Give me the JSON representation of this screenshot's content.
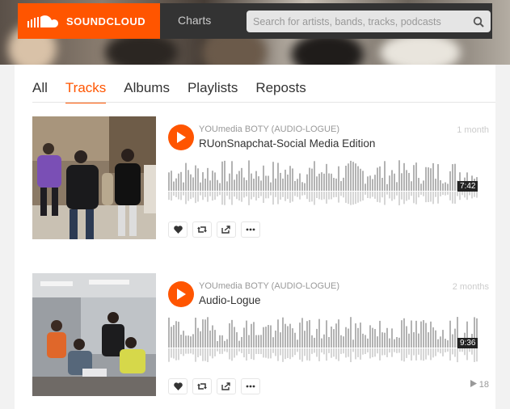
{
  "header": {
    "brand": "SOUNDCLOUD",
    "nav_charts": "Charts",
    "search_placeholder": "Search for artists, bands, tracks, podcasts"
  },
  "tabs": [
    {
      "label": "All",
      "active": false
    },
    {
      "label": "Tracks",
      "active": true
    },
    {
      "label": "Albums",
      "active": false
    },
    {
      "label": "Playlists",
      "active": false
    },
    {
      "label": "Reposts",
      "active": false
    }
  ],
  "tracks": [
    {
      "uploader": "YOUmedia BOTY (AUDIO-LOGUE)",
      "title": "RUonSnapchat-Social Media Edition",
      "posted": "1 month",
      "duration": "7:42",
      "plays": ""
    },
    {
      "uploader": "YOUmedia BOTY (AUDIO-LOGUE)",
      "title": "Audio-Logue",
      "posted": "2 months",
      "duration": "9:36",
      "plays": "18"
    }
  ],
  "colors": {
    "accent": "#ff5500",
    "topbar": "#333333",
    "waveform": "#b3b3b3"
  },
  "icons": [
    "soundcloud-logo-icon",
    "search-icon",
    "play-icon",
    "like-icon",
    "repost-icon",
    "share-icon",
    "more-icon",
    "plays-icon"
  ]
}
